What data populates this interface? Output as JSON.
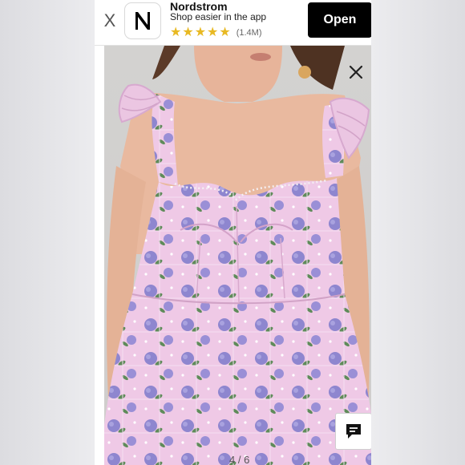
{
  "banner": {
    "close_label": "X",
    "app_icon_letter": "N",
    "app_name": "Nordstrom",
    "subtitle": "Shop easier in the app",
    "rating_stars": 5,
    "rating_count": "(1.4M)",
    "open_label": "Open"
  },
  "gallery": {
    "counter": "4 / 6"
  },
  "colors": {
    "accent_black": "#000000",
    "star": "#e8b923",
    "dress_pink": "#efc8e6",
    "flower_purple": "#8f84d0"
  },
  "icons": [
    "close-icon",
    "chat-icon",
    "star-icon"
  ]
}
